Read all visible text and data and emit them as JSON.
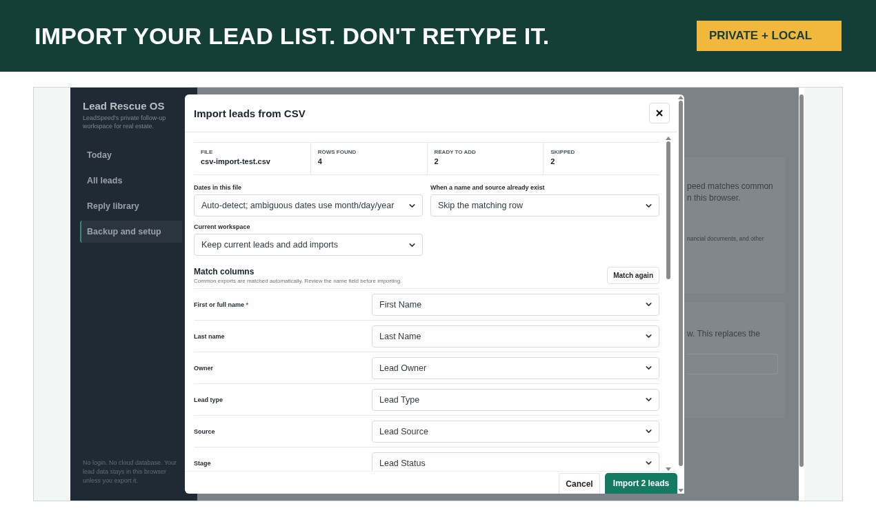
{
  "banner": {
    "title": "IMPORT YOUR LEAD LIST. DON'T RETYPE IT.",
    "badge": "PRIVATE + LOCAL"
  },
  "sidebar": {
    "title": "Lead Rescue OS",
    "subtitle": "LeadSpeed's private follow-up workspace for real estate.",
    "items": [
      {
        "label": "Today",
        "selected": false
      },
      {
        "label": "All leads",
        "selected": false
      },
      {
        "label": "Reply library",
        "selected": false
      },
      {
        "label": "Backup and setup",
        "selected": true
      }
    ],
    "footer": "No login. No cloud database. Your lead data stays in this browser unless you export it."
  },
  "background_cards": [
    {
      "lines": [
        "peed matches common",
        "n this browser."
      ],
      "note": "nancial documents, and other",
      "has_field": false
    },
    {
      "lines": [
        "w. This replaces the"
      ],
      "has_field": true
    }
  ],
  "dialog": {
    "title": "Import leads from CSV",
    "stats": [
      {
        "label": "FILE",
        "value": "csv-import-test.csv"
      },
      {
        "label": "ROWS FOUND",
        "value": "4"
      },
      {
        "label": "READY TO ADD",
        "value": "2"
      },
      {
        "label": "SKIPPED",
        "value": "2"
      }
    ],
    "options": [
      {
        "label": "Dates in this file",
        "value": "Auto-detect; ambiguous dates use month/day/year"
      },
      {
        "label": "When a name and source already exist",
        "value": "Skip the matching row"
      },
      {
        "label": "Current workspace",
        "value": "Keep current leads and add imports"
      }
    ],
    "match": {
      "title": "Match columns",
      "hint": "Common exports are matched automatically. Review the name field before importing.",
      "button": "Match again",
      "rows": [
        {
          "label": "First or full name",
          "required_mark": "*",
          "value": "First Name"
        },
        {
          "label": "Last name",
          "value": "Last Name"
        },
        {
          "label": "Owner",
          "value": "Lead Owner"
        },
        {
          "label": "Lead type",
          "value": "Lead Type"
        },
        {
          "label": "Source",
          "value": "Lead Source"
        },
        {
          "label": "Stage",
          "value": "Lead Status"
        }
      ]
    },
    "buttons": {
      "cancel": "Cancel",
      "submit": "Import 2 leads"
    }
  }
}
